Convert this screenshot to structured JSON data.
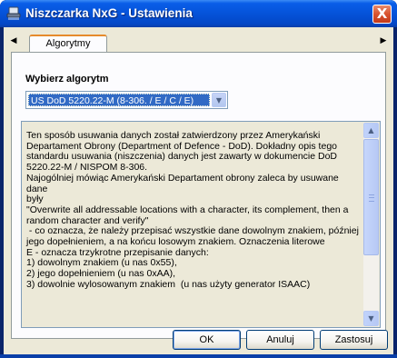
{
  "window": {
    "title": "Niszczarka NxG - Ustawienia",
    "close_label": "X"
  },
  "tabs": {
    "items": [
      {
        "label": "Algorytmy",
        "active": true
      }
    ],
    "scroll_left_icon": "arrow-left-icon",
    "scroll_right_icon": "arrow-right-icon"
  },
  "algorithm": {
    "section_label": "Wybierz algorytm",
    "selected": "US DoD 5220.22-M (8-306. / E / C / E)"
  },
  "description": {
    "lines": [
      "Ten sposób usuwania danych został zatwierdzony przez Amerykański",
      "Departament Obrony (Department of Defence - DoD). Dokładny opis tego",
      "standardu usuwania (niszczenia) danych jest zawarty w dokumencie DoD",
      "5220.22-M / NISPOM 8-306.",
      "Najogólniej mówiąc Amerykański Departament obrony zaleca by usuwane dane",
      "były",
      "\"Overwrite all addressable locations with a character, its complement, then a",
      "random character and verify\"",
      " - co oznacza, że należy przepisać wszystkie dane dowolnym znakiem, później",
      "jego dopełnieniem, a na końcu losowym znakiem. Oznaczenia literowe",
      "E - oznacza trzykrotne przepisanie danych:",
      "1) dowolnym znakiem (u nas 0x55),",
      "2) jego dopełnieniem (u nas 0xAA),",
      "3) dowolnie wylosowanym znakiem  (u nas użyty generator ISAAC)"
    ]
  },
  "buttons": {
    "ok": "OK",
    "cancel": "Anuluj",
    "apply": "Zastosuj"
  },
  "colors": {
    "title_bar": "#0553d9",
    "dialog_face": "#ece9d8",
    "selection": "#316ac5",
    "close_button": "#d9532e"
  }
}
